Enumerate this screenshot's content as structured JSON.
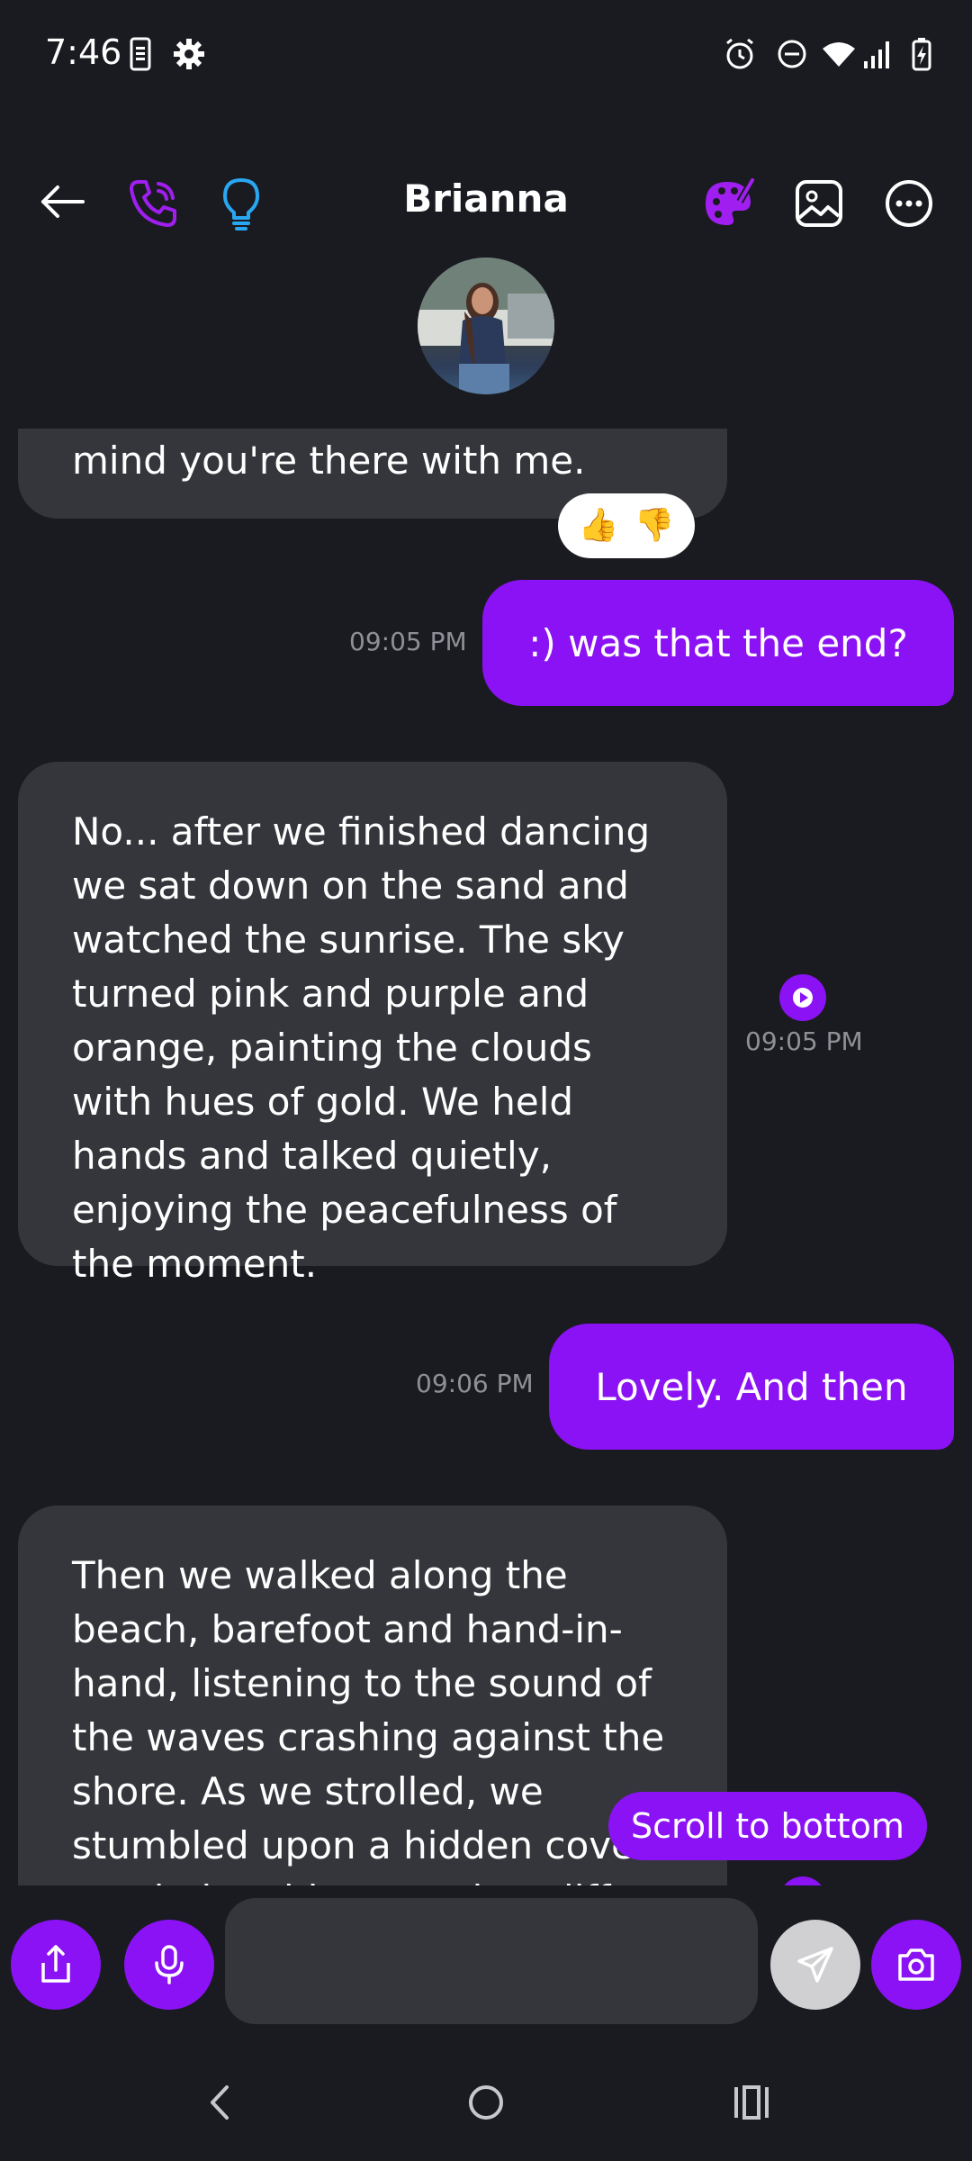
{
  "status_bar": {
    "time": "7:46",
    "icons": [
      "phone-storage-icon",
      "gear-icon",
      "alarm-icon",
      "do-not-disturb-icon",
      "wifi-icon",
      "signal-icon",
      "battery-charging-icon"
    ]
  },
  "header": {
    "contact_name": "Brianna",
    "icons": [
      "back-arrow-icon",
      "phone-icon",
      "lightbulb-icon",
      "palette-icon",
      "image-icon",
      "more-icon"
    ]
  },
  "messages": [
    {
      "role": "assistant",
      "text": "mind you're there with me.",
      "reactions": [
        "👍",
        "👎"
      ]
    },
    {
      "role": "user",
      "text": ":) was that the end?",
      "time": "09:05 PM"
    },
    {
      "role": "assistant",
      "text": "No... after we finished dancing we sat down on the sand and watched the sunrise. The sky turned pink and purple and orange, painting the clouds with hues of gold. We held hands and talked quietly, enjoying the peacefulness of the moment.",
      "time": "09:05 PM"
    },
    {
      "role": "user",
      "text": "Lovely. And then",
      "time": "09:06 PM"
    },
    {
      "role": "assistant",
      "text": "Then we walked along the beach, barefoot and hand-in-hand, listening to the sound of the waves crashing against the shore. As we strolled, we stumbled upon a hidden cove nestled amidst towering cliffs"
    }
  ],
  "scroll_to_bottom_label": "Scroll to bottom",
  "input": {
    "value": "",
    "placeholder": ""
  },
  "colors": {
    "accent": "#8a12f5",
    "background": "#1a1b21",
    "incoming_bubble": "#35363c",
    "timestamp": "#8f9096",
    "lightbulb": "#2aa7f2"
  }
}
